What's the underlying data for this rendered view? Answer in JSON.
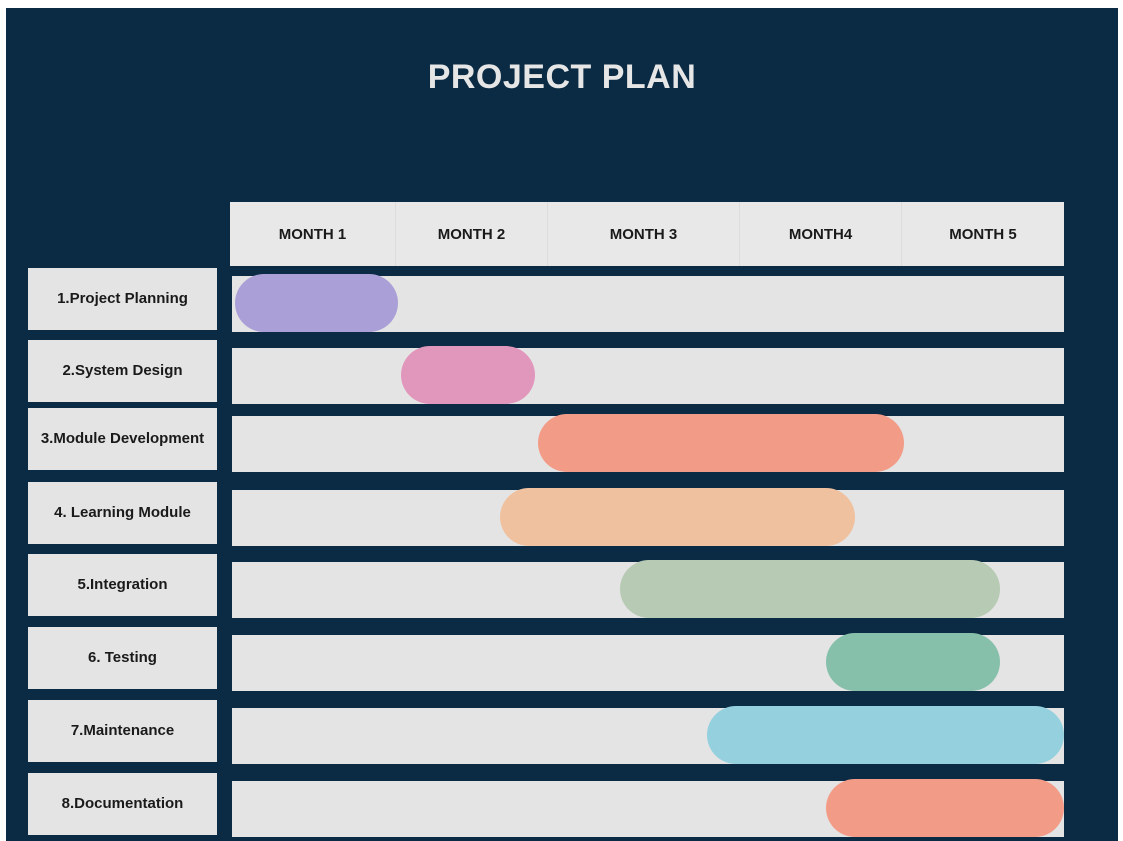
{
  "chart_data": {
    "type": "gantt",
    "title": "PROJECT PLAN",
    "xlabel": "",
    "ylabel": "",
    "months": [
      "MONTH 1",
      "MONTH 2",
      "MONTH 3",
      "MONTH4",
      "MONTH 5"
    ],
    "x_range": [
      0,
      5
    ],
    "tasks": [
      {
        "label": "1.Project Planning",
        "start": 0.0,
        "end": 1.0,
        "color": "#ab9fd7"
      },
      {
        "label": "2.System Design",
        "start": 1.0,
        "end": 1.9,
        "color": "#e196bc"
      },
      {
        "label": "3.Module Development",
        "start": 1.9,
        "end": 4.0,
        "color": "#f29c88"
      },
      {
        "label": "4. Learning Module",
        "start": 1.65,
        "end": 3.7,
        "color": "#f0c19e"
      },
      {
        "label": "5.Integration",
        "start": 2.35,
        "end": 4.6,
        "color": "#b7cab3"
      },
      {
        "label": "6. Testing",
        "start": 3.5,
        "end": 4.6,
        "color": "#86c0ab"
      },
      {
        "label": "7.Maintenance",
        "start": 2.8,
        "end": 5.0,
        "color": "#94d0de"
      },
      {
        "label": "8.Documentation",
        "start": 3.5,
        "end": 5.0,
        "color": "#f29c88"
      }
    ]
  },
  "colors": {
    "background": "#0b2b44",
    "panel": "#e4e4e4",
    "title_text": "#e6e6e6"
  }
}
